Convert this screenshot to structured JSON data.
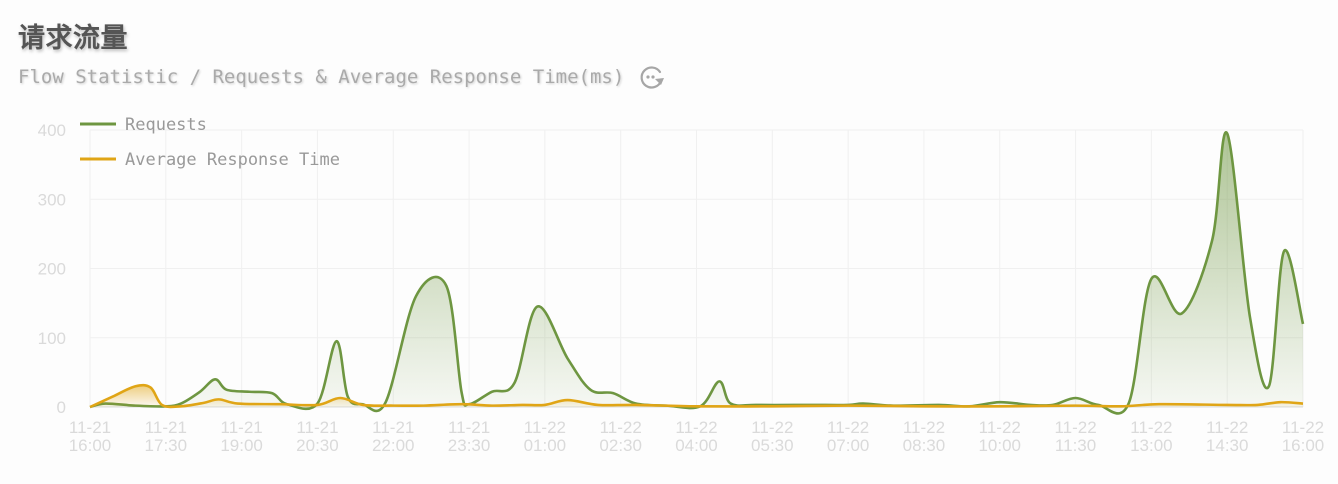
{
  "header": {
    "title": "请求流量",
    "subtitle": "Flow Statistic / Requests & Average Response Time(ms)"
  },
  "icons": {
    "refresh": "refresh-icon"
  },
  "colors": {
    "requests": "#6e9641",
    "avg": "#e0a516",
    "grid": "#f0f0f0",
    "axis_text": "#d9d9d9"
  },
  "chart_data": {
    "type": "area",
    "x": [
      "11-21 16:00",
      "11-21 17:30",
      "11-21 19:00",
      "11-21 20:30",
      "11-21 22:00",
      "11-21 23:30",
      "11-22 01:00",
      "11-22 02:30",
      "11-22 04:00",
      "11-22 05:30",
      "11-22 07:00",
      "11-22 08:30",
      "11-22 10:00",
      "11-22 11:30",
      "11-22 13:00",
      "11-22 14:30",
      "11-22 16:00"
    ],
    "ylim": [
      0,
      400
    ],
    "yticks": [
      0,
      100,
      200,
      300,
      400
    ],
    "legend_position": "top-left",
    "grid": true,
    "series": [
      {
        "name": "Requests",
        "points": [
          [
            0,
            0
          ],
          [
            0.2,
            5
          ],
          [
            0.6,
            2
          ],
          [
            1.0,
            1
          ],
          [
            1.2,
            5
          ],
          [
            1.45,
            22
          ],
          [
            1.65,
            40
          ],
          [
            1.8,
            25
          ],
          [
            2.1,
            22
          ],
          [
            2.4,
            20
          ],
          [
            2.6,
            4
          ],
          [
            3.0,
            5
          ],
          [
            3.25,
            95
          ],
          [
            3.4,
            15
          ],
          [
            3.6,
            4
          ],
          [
            3.9,
            7
          ],
          [
            4.3,
            160
          ],
          [
            4.7,
            175
          ],
          [
            4.9,
            22
          ],
          [
            5.0,
            4
          ],
          [
            5.3,
            22
          ],
          [
            5.6,
            35
          ],
          [
            5.9,
            145
          ],
          [
            6.3,
            70
          ],
          [
            6.6,
            25
          ],
          [
            6.9,
            20
          ],
          [
            7.2,
            5
          ],
          [
            7.6,
            2
          ],
          [
            8.05,
            1
          ],
          [
            8.3,
            37
          ],
          [
            8.45,
            5
          ],
          [
            8.8,
            3
          ],
          [
            9.5,
            3
          ],
          [
            10,
            3
          ],
          [
            10.2,
            5
          ],
          [
            10.6,
            2
          ],
          [
            11.2,
            3
          ],
          [
            11.6,
            1
          ],
          [
            12,
            7
          ],
          [
            12.4,
            3
          ],
          [
            12.7,
            3
          ],
          [
            13,
            13
          ],
          [
            13.3,
            3
          ],
          [
            13.7,
            5
          ],
          [
            14.0,
            185
          ],
          [
            14.4,
            135
          ],
          [
            14.8,
            240
          ],
          [
            15.0,
            395
          ],
          [
            15.3,
            130
          ],
          [
            15.55,
            30
          ],
          [
            15.75,
            225
          ],
          [
            16.0,
            120
          ]
        ]
      },
      {
        "name": "Average Response Time",
        "points": [
          [
            0,
            0
          ],
          [
            0.3,
            15
          ],
          [
            0.6,
            30
          ],
          [
            0.8,
            28
          ],
          [
            0.95,
            3
          ],
          [
            1.2,
            1
          ],
          [
            1.5,
            6
          ],
          [
            1.7,
            11
          ],
          [
            1.95,
            5
          ],
          [
            2.5,
            4
          ],
          [
            3.0,
            3
          ],
          [
            3.3,
            13
          ],
          [
            3.6,
            3
          ],
          [
            4.0,
            2
          ],
          [
            4.4,
            2
          ],
          [
            4.9,
            4
          ],
          [
            5.3,
            2
          ],
          [
            5.7,
            3
          ],
          [
            6.0,
            3
          ],
          [
            6.3,
            10
          ],
          [
            6.7,
            3
          ],
          [
            7.2,
            3
          ],
          [
            8.0,
            1
          ],
          [
            9.0,
            1
          ],
          [
            10,
            2
          ],
          [
            11,
            1
          ],
          [
            12,
            1
          ],
          [
            13,
            2
          ],
          [
            13.6,
            1
          ],
          [
            14.1,
            4
          ],
          [
            15.0,
            3
          ],
          [
            15.4,
            3
          ],
          [
            15.7,
            7
          ],
          [
            16.0,
            5
          ]
        ]
      }
    ]
  }
}
